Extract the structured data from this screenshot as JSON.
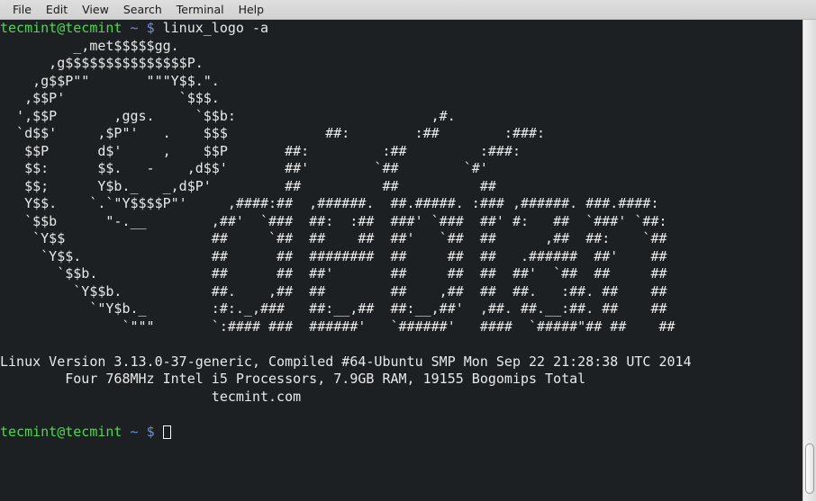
{
  "window": {
    "title": "Terminal",
    "background_color": "#1c2023",
    "foreground_color": "#e9e9e9",
    "prompt_user_color": "#4ed84e",
    "prompt_symbol_color": "#6f8fd8"
  },
  "menubar": {
    "items": [
      {
        "label": "File"
      },
      {
        "label": "Edit"
      },
      {
        "label": "View"
      },
      {
        "label": "Search"
      },
      {
        "label": "Terminal"
      },
      {
        "label": "Help"
      }
    ]
  },
  "terminal": {
    "prompt_user": "tecmint@tecmint",
    "prompt_path": "~",
    "prompt_symbol": "$",
    "command": "linux_logo -a",
    "cursor": "block-outline-cursor",
    "logo_lines": [
      "         _,met$$$$$gg.",
      "      ,g$$$$$$$$$$$$$$$P.",
      "    ,g$$P\"\"       \"\"\"Y$$.\".",
      "   ,$$P'              `$$$.",
      "  ',$$P       ,ggs.     `$$b:                        ,#.",
      "  `d$$'     ,$P\"'   .    $$$            ##:        :##        :###:",
      "   $$P      d$'     ,    $$P       ##:         :##         :###:",
      "   $$:      $$.   -    ,d$$'       ##'        `##        `#'",
      "   $$;      Y$b._   _,d$P'         ##          ##          ##",
      "   Y$$.    `.`\"Y$$$$P\"'     ,####:##  ,######.  ##.#####. :### ,######. ###.####:",
      "   `$$b      \"-.__        ,##'  `###  ##:  :##  ###' `###  ##' #:   ##  `###' `##:",
      "    `Y$$                  ##     `##  ##    ##  ##'   `##  ##      ,##  ##:    `##",
      "     `Y$$.                ##      ##  ########  ##     ##  ##   .######  ##'    ##",
      "       `$$b.              ##      ##  ##'       ##     ##  ##  ##'  `##  ##     ##",
      "         `Y$$b.           ##.    ,##  ##        ##    ,##  ##  ##.   :##. ##    ##",
      "           `\"Y$b._        :#:._,###   ##:__,##  ##:__,##'  ,##. ##.__:##. ##    ##",
      "               `\"\"\"       `:#### ###  ######'   `######'   ####  `#####\"## ##    ##"
    ],
    "info_lines": [
      "Linux Version 3.13.0-37-generic, Compiled #64-Ubuntu SMP Mon Sep 22 21:28:38 UTC 2014",
      "        Four 768MHz Intel i5 Processors, 7.9GB RAM, 19155 Bogomips Total",
      "                          tecmint.com"
    ]
  },
  "scrollbar": {
    "name": "vertical-scrollbar",
    "thumb_position": "bottom"
  }
}
